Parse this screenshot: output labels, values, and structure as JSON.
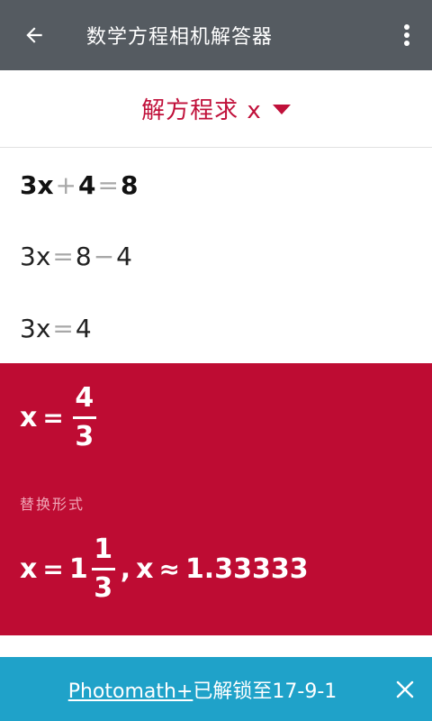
{
  "appbar": {
    "title": "数学方程相机解答器",
    "back_icon": "arrow-left-icon",
    "more_icon": "more-vert-icon"
  },
  "mode": {
    "label": "解方程求 x",
    "dropdown_icon": "caret-down-icon"
  },
  "steps": [
    {
      "lhs": "3x",
      "op1": "+",
      "mid": "4",
      "op2": "=",
      "rhs": "8"
    },
    {
      "lhs": "3x",
      "op1": "=",
      "mid": "8",
      "op2": "−",
      "rhs": "4"
    },
    {
      "lhs": "3x",
      "op1": "=",
      "rhs": "4"
    }
  ],
  "result": {
    "var": "x",
    "eq": "=",
    "numerator": "4",
    "denominator": "3",
    "alt_label": "替换形式",
    "alt": {
      "var": "x",
      "eq": "=",
      "whole": "1",
      "numerator": "1",
      "denominator": "3",
      "sep": ",",
      "var2": "x",
      "approx": "≈",
      "decimal": "1.33333"
    }
  },
  "banner": {
    "link_text": "Photomath+",
    "text": "已解锁至17-9-1",
    "close_icon": "close-icon"
  },
  "colors": {
    "appbar": "#555b61",
    "accent": "#c0103a",
    "result_bg": "#be0c33",
    "banner_bg": "#1fa2c9"
  }
}
